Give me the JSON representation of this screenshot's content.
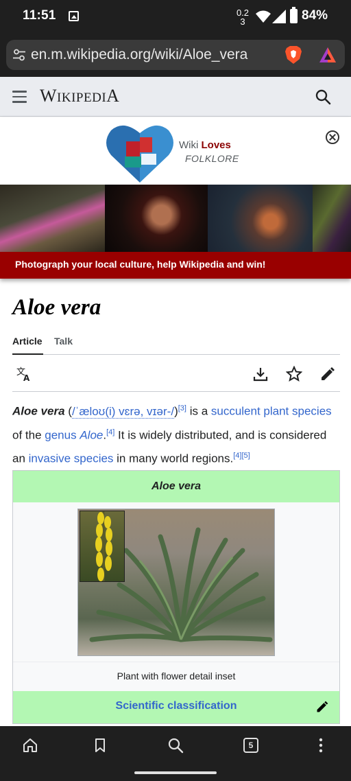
{
  "status_bar": {
    "time": "11:51",
    "data_speed": "0.2\n3",
    "battery": "84%"
  },
  "browser": {
    "url": "en.m.wikipedia.org/wiki/Aloe_vera",
    "open_tabs": "5"
  },
  "header": {
    "wordmark_big_w": "W",
    "wordmark_rest": "IKIPEDI",
    "wordmark_big_a": "A"
  },
  "banner": {
    "brand_prefix": "Wiki ",
    "brand_emph": "Loves",
    "brand_sub": "FOLKLORE",
    "cta": "Photograph your local culture, help Wikipedia and win!",
    "accent": "#990000"
  },
  "article": {
    "title": "Aloe vera",
    "tabs": [
      {
        "label": "Article"
      },
      {
        "label": "Talk"
      }
    ],
    "lead": {
      "term": "Aloe vera",
      "pron_open": " (",
      "ipa": "/ˈæloʊ(i) vɛrə, vɪər-/",
      "pron_close": ")",
      "ref3": "[3]",
      "t1": " is a ",
      "link_succulent": "succulent plant species",
      "t2": " of the ",
      "link_genus": "genus",
      "t3": " ",
      "link_aloe": "Aloe",
      "t4": ".",
      "ref4": "[4]",
      "t5": " It is widely distributed, and is considered an ",
      "link_invasive": "invasive species",
      "t6": " in many world regions.",
      "ref4b": "[4]",
      "ref5": "[5]"
    },
    "infobox": {
      "title": "Aloe vera",
      "caption": "Plant with flower detail inset",
      "section": "Scientific classification"
    }
  },
  "colors": {
    "link": "#3366cc",
    "infobox_header": "#b3f7b3",
    "chrome": "#1f1f1f"
  }
}
